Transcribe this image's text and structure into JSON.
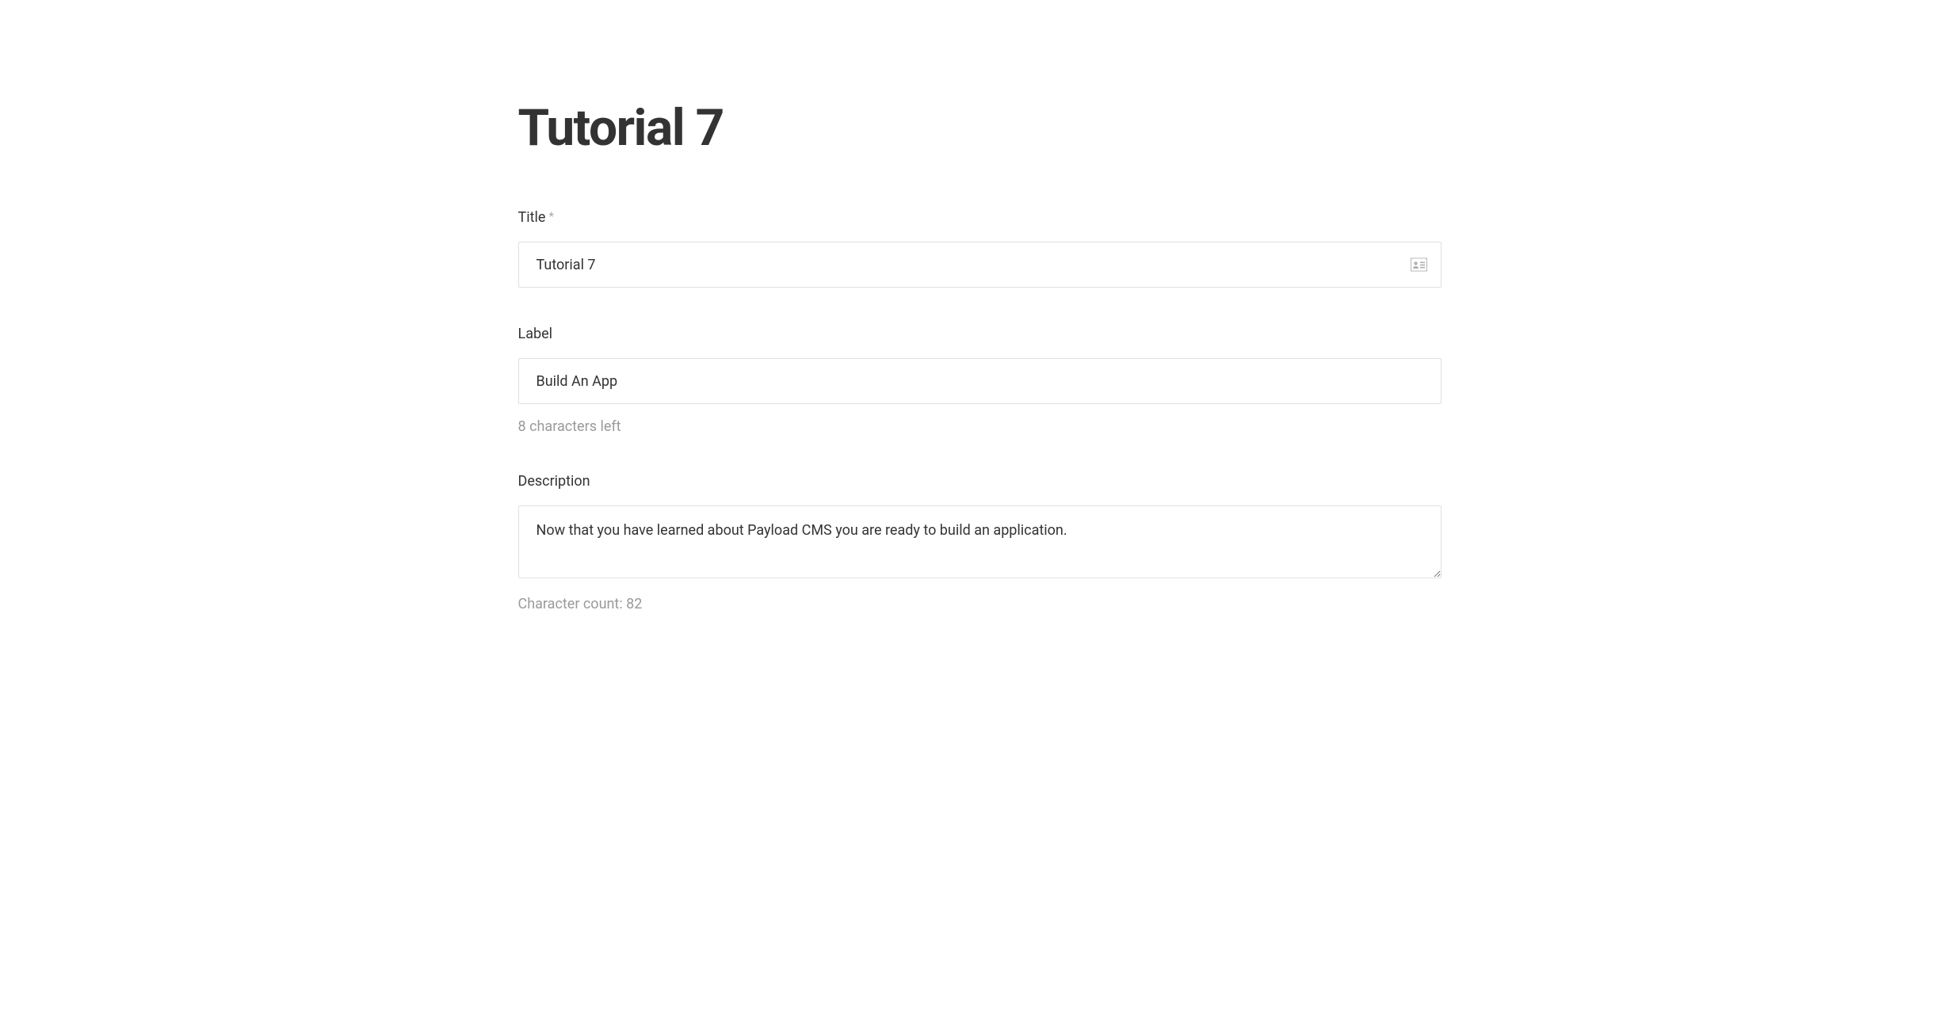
{
  "page": {
    "heading": "Tutorial 7"
  },
  "fields": {
    "title": {
      "label": "Title",
      "required_mark": "*",
      "value": "Tutorial 7"
    },
    "label": {
      "label": "Label",
      "value": "Build An App",
      "helper": "8 characters left"
    },
    "description": {
      "label": "Description",
      "value": "Now that you have learned about Payload CMS you are ready to build an application.",
      "helper": "Character count: 82"
    }
  }
}
